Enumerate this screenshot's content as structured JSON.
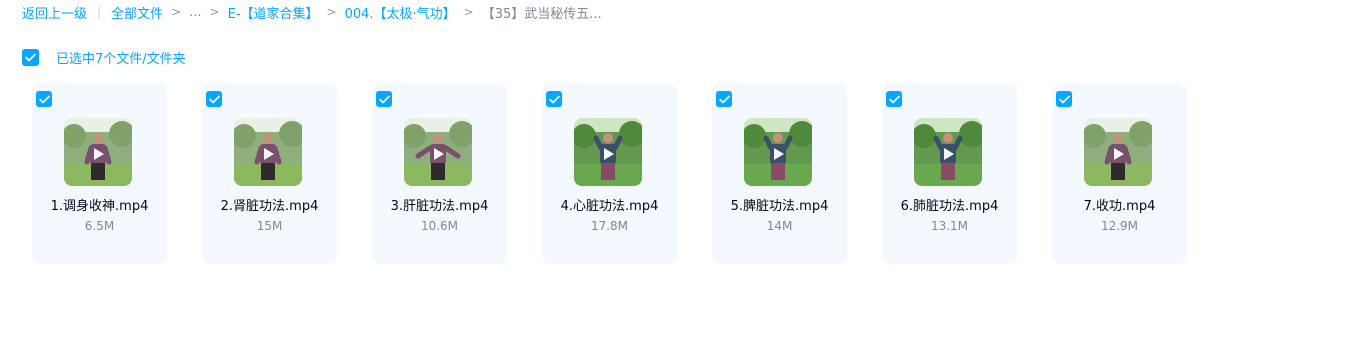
{
  "breadcrumb": {
    "back": "返回上一级",
    "separator_bar": "|",
    "root": "全部文件",
    "separator": ">",
    "ellipsis": "...",
    "level1": "E-【道家合集】",
    "level2": "004.【太极·气功】",
    "current": "【35】武当秘传五..."
  },
  "selection": {
    "label": "已选中7个文件/文件夹"
  },
  "files": [
    {
      "name": "1.调身收神.mp4",
      "size": "6.5M",
      "checked": true,
      "scene": "purple-shirt"
    },
    {
      "name": "2.肾脏功法.mp4",
      "size": "15M",
      "checked": true,
      "scene": "purple-shirt"
    },
    {
      "name": "3.肝脏功法.mp4",
      "size": "10.6M",
      "checked": true,
      "scene": "purple-shirt-arms-out"
    },
    {
      "name": "4.心脏功法.mp4",
      "size": "17.8M",
      "checked": true,
      "scene": "green-forest"
    },
    {
      "name": "5.脾脏功法.mp4",
      "size": "14M",
      "checked": true,
      "scene": "green-forest"
    },
    {
      "name": "6.肺脏功法.mp4",
      "size": "13.1M",
      "checked": true,
      "scene": "green-forest"
    },
    {
      "name": "7.收功.mp4",
      "size": "12.9M",
      "checked": true,
      "scene": "purple-shirt"
    }
  ],
  "colors": {
    "accent": "#06a7ff",
    "card_bg": "#f3f9ff",
    "muted": "#818999"
  }
}
